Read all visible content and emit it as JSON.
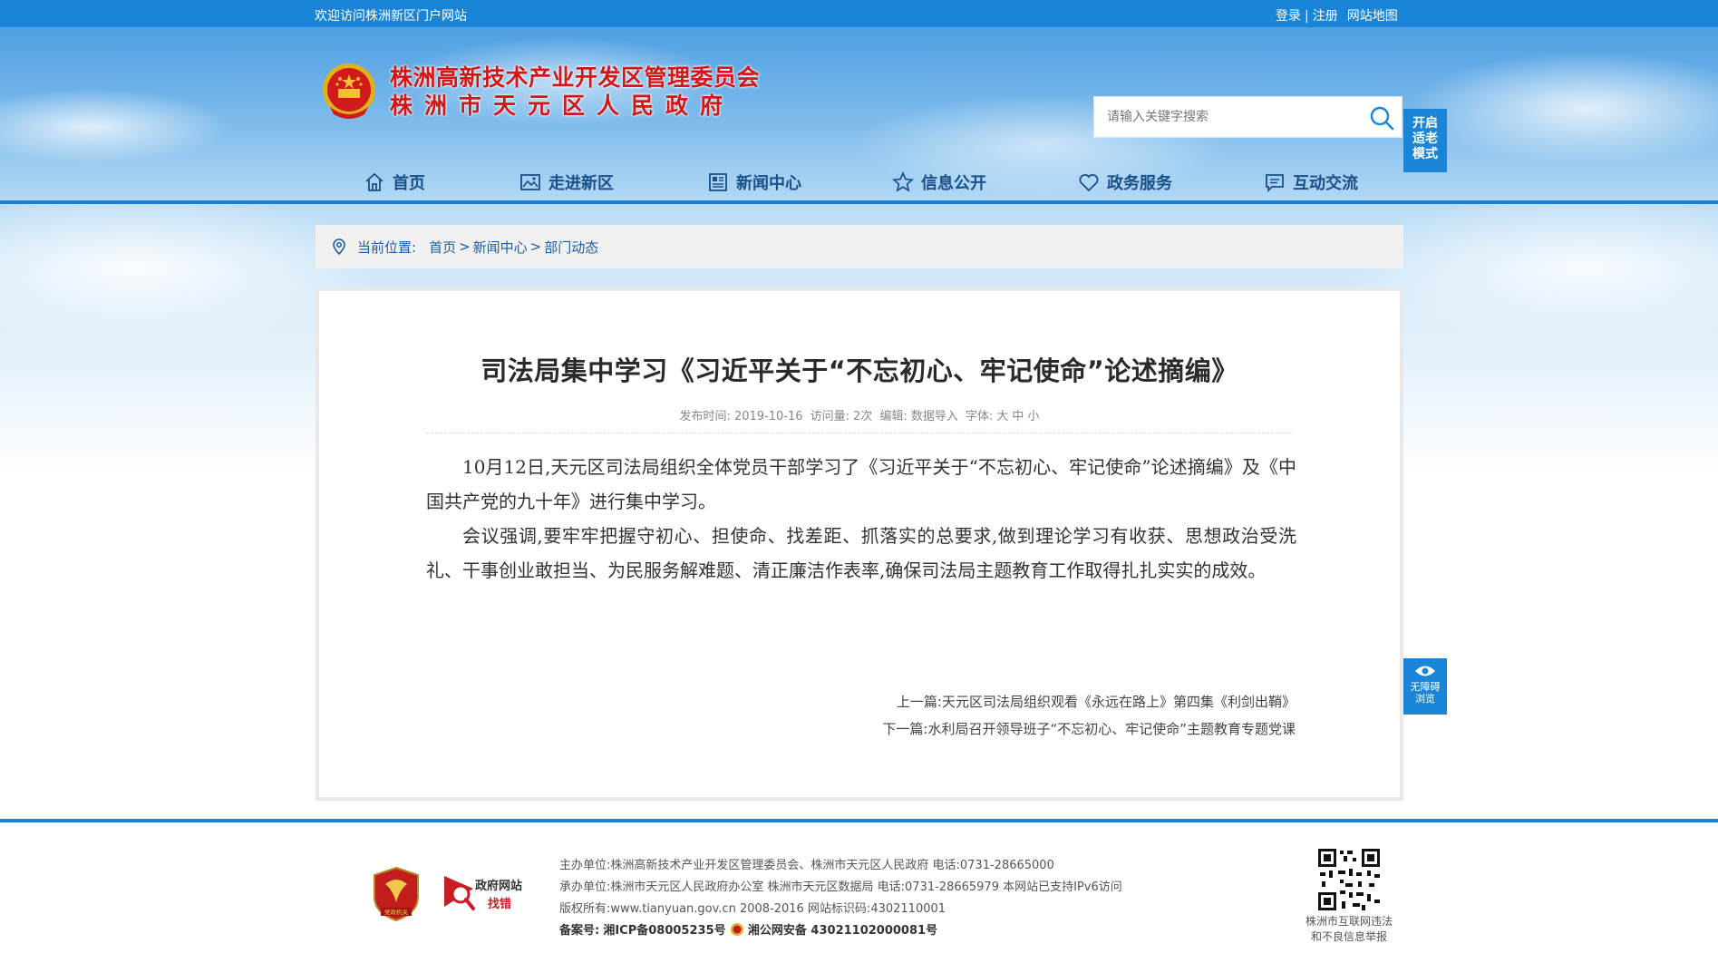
{
  "topbar": {
    "welcome": "欢迎访问株洲新区门户网站",
    "login": "登录",
    "separator": "|",
    "register": "注册",
    "sitemap": "网站地图"
  },
  "header": {
    "org_name_1": "株洲高新技术产业开发区管理委员会",
    "org_name_2": "株洲市天元区人民政府",
    "search_placeholder": "请输入关键字搜索",
    "elder_mode": [
      "开启",
      "适老",
      "模式"
    ]
  },
  "nav": {
    "items": [
      {
        "label": "首页",
        "icon": "home-icon"
      },
      {
        "label": "走进新区",
        "icon": "image-icon"
      },
      {
        "label": "新闻中心",
        "icon": "newspaper-icon"
      },
      {
        "label": "信息公开",
        "icon": "star-icon"
      },
      {
        "label": "政务服务",
        "icon": "heart-icon"
      },
      {
        "label": "互动交流",
        "icon": "chat-icon"
      }
    ]
  },
  "breadcrumb": {
    "label": "当前位置:",
    "items": [
      "首页",
      "新闻中心",
      "部门动态"
    ],
    "separator": ">"
  },
  "article": {
    "title": "司法局集中学习《习近平关于“不忘初心、牢记使命”论述摘编》",
    "meta": {
      "published_label": "发布时间:",
      "published_date": "2019-10-16",
      "views_label": "访问量:",
      "views": "2次",
      "editor_label": "编辑:",
      "editor": "数据导入",
      "font_label": "字体:",
      "font_large": "大",
      "font_medium": "中",
      "font_small": "小"
    },
    "paragraphs": [
      "10月12日,天元区司法局组织全体党员干部学习了《习近平关于“不忘初心、牢记使命”论述摘编》及《中国共产党的九十年》进行集中学习。",
      "会议强调,要牢牢把握守初心、担使命、找差距、抓落实的总要求,做到理论学习有收获、思想政治受洗礼、干事创业敢担当、为民服务解难题、清正廉洁作表率,确保司法局主题教育工作取得扎扎实实的成效。"
    ],
    "prev_label": "上一篇:",
    "prev_title": "天元区司法局组织观看《永远在路上》第四集《利剑出鞘》",
    "next_label": "下一篇:",
    "next_title": "水利局召开领导班子“不忘初心、牢记使命”主题教育专题党课"
  },
  "accessibility": {
    "label_1": "无障碍",
    "label_2": "浏览"
  },
  "footer": {
    "badge_1_text": "党政机关",
    "badge_2_text_1": "政府网站",
    "badge_2_text_2": "找错",
    "host": "主办单位:株洲高新技术产业开发区管理委员会、株洲市天元区人民政府 电话:0731-28665000",
    "operator": "承办单位:株洲市天元区人民政府办公室 株洲市天元区数据局 电话:0731-28665979 本网站已支持IPv6访问",
    "copyright": "版权所有:www.tianyuan.gov.cn 2008-2016 网站标识码:4302110001",
    "icp_label": "备案号:",
    "icp": "湘ICP备08005235号",
    "police": "湘公网安备 43021102000081号",
    "qr_caption_1": "株洲市互联网违法",
    "qr_caption_2": "和不良信息举报"
  },
  "colors": {
    "primary_blue": "#1a85d6",
    "title_red": "#d01818",
    "nav_text": "#1a4f8a"
  }
}
